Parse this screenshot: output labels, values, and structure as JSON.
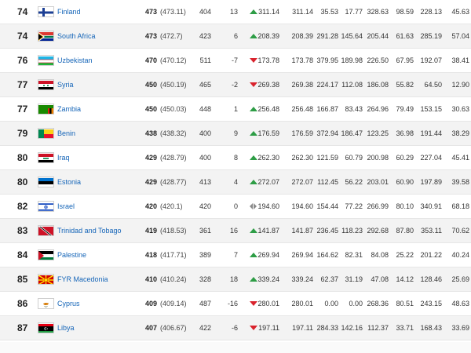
{
  "rows": [
    {
      "rank": "74",
      "country": "Finland",
      "flag": "finland-flag",
      "points": "473",
      "points_exact": "(473.11)",
      "prev_points": "404",
      "change": "13",
      "trend": "up",
      "c1": "311.14",
      "c2": "311.14",
      "c3": "35.53",
      "c4": "17.77",
      "c5": "328.63",
      "c6": "98.59",
      "c7": "228.13",
      "c8": "45.63"
    },
    {
      "rank": "74",
      "country": "South Africa",
      "flag": "south-africa-flag",
      "points": "473",
      "points_exact": "(472.7)",
      "prev_points": "423",
      "change": "6",
      "trend": "up",
      "c1": "208.39",
      "c2": "208.39",
      "c3": "291.28",
      "c4": "145.64",
      "c5": "205.44",
      "c6": "61.63",
      "c7": "285.19",
      "c8": "57.04"
    },
    {
      "rank": "76",
      "country": "Uzbekistan",
      "flag": "uzbekistan-flag",
      "points": "470",
      "points_exact": "(470.12)",
      "prev_points": "511",
      "change": "-7",
      "trend": "down",
      "c1": "173.78",
      "c2": "173.78",
      "c3": "379.95",
      "c4": "189.98",
      "c5": "226.50",
      "c6": "67.95",
      "c7": "192.07",
      "c8": "38.41"
    },
    {
      "rank": "77",
      "country": "Syria",
      "flag": "syria-flag",
      "points": "450",
      "points_exact": "(450.19)",
      "prev_points": "465",
      "change": "-2",
      "trend": "down",
      "c1": "269.38",
      "c2": "269.38",
      "c3": "224.17",
      "c4": "112.08",
      "c5": "186.08",
      "c6": "55.82",
      "c7": "64.50",
      "c8": "12.90"
    },
    {
      "rank": "77",
      "country": "Zambia",
      "flag": "zambia-flag",
      "points": "450",
      "points_exact": "(450.03)",
      "prev_points": "448",
      "change": "1",
      "trend": "up",
      "c1": "256.48",
      "c2": "256.48",
      "c3": "166.87",
      "c4": "83.43",
      "c5": "264.96",
      "c6": "79.49",
      "c7": "153.15",
      "c8": "30.63"
    },
    {
      "rank": "79",
      "country": "Benin",
      "flag": "benin-flag",
      "points": "438",
      "points_exact": "(438.32)",
      "prev_points": "400",
      "change": "9",
      "trend": "up",
      "c1": "176.59",
      "c2": "176.59",
      "c3": "372.94",
      "c4": "186.47",
      "c5": "123.25",
      "c6": "36.98",
      "c7": "191.44",
      "c8": "38.29"
    },
    {
      "rank": "80",
      "country": "Iraq",
      "flag": "iraq-flag",
      "points": "429",
      "points_exact": "(428.79)",
      "prev_points": "400",
      "change": "8",
      "trend": "up",
      "c1": "262.30",
      "c2": "262.30",
      "c3": "121.59",
      "c4": "60.79",
      "c5": "200.98",
      "c6": "60.29",
      "c7": "227.04",
      "c8": "45.41"
    },
    {
      "rank": "80",
      "country": "Estonia",
      "flag": "estonia-flag",
      "points": "429",
      "points_exact": "(428.77)",
      "prev_points": "413",
      "change": "4",
      "trend": "up",
      "c1": "272.07",
      "c2": "272.07",
      "c3": "112.45",
      "c4": "56.22",
      "c5": "203.01",
      "c6": "60.90",
      "c7": "197.89",
      "c8": "39.58"
    },
    {
      "rank": "82",
      "country": "Israel",
      "flag": "israel-flag",
      "points": "420",
      "points_exact": "(420.1)",
      "prev_points": "420",
      "change": "0",
      "trend": "same",
      "c1": "194.60",
      "c2": "194.60",
      "c3": "154.44",
      "c4": "77.22",
      "c5": "266.99",
      "c6": "80.10",
      "c7": "340.91",
      "c8": "68.18"
    },
    {
      "rank": "83",
      "country": "Trinidad and Tobago",
      "flag": "trinidad-and-tobago-flag",
      "points": "419",
      "points_exact": "(418.53)",
      "prev_points": "361",
      "change": "16",
      "trend": "up",
      "c1": "141.87",
      "c2": "141.87",
      "c3": "236.45",
      "c4": "118.23",
      "c5": "292.68",
      "c6": "87.80",
      "c7": "353.11",
      "c8": "70.62"
    },
    {
      "rank": "84",
      "country": "Palestine",
      "flag": "palestine-flag",
      "points": "418",
      "points_exact": "(417.71)",
      "prev_points": "389",
      "change": "7",
      "trend": "up",
      "c1": "269.94",
      "c2": "269.94",
      "c3": "164.62",
      "c4": "82.31",
      "c5": "84.08",
      "c6": "25.22",
      "c7": "201.22",
      "c8": "40.24"
    },
    {
      "rank": "85",
      "country": "FYR Macedonia",
      "flag": "fyr-macedonia-flag",
      "points": "410",
      "points_exact": "(410.24)",
      "prev_points": "328",
      "change": "18",
      "trend": "up",
      "c1": "339.24",
      "c2": "339.24",
      "c3": "62.37",
      "c4": "31.19",
      "c5": "47.08",
      "c6": "14.12",
      "c7": "128.46",
      "c8": "25.69"
    },
    {
      "rank": "86",
      "country": "Cyprus",
      "flag": "cyprus-flag",
      "points": "409",
      "points_exact": "(409.14)",
      "prev_points": "487",
      "change": "-16",
      "trend": "down",
      "c1": "280.01",
      "c2": "280.01",
      "c3": "0.00",
      "c4": "0.00",
      "c5": "268.36",
      "c6": "80.51",
      "c7": "243.15",
      "c8": "48.63"
    },
    {
      "rank": "87",
      "country": "Libya",
      "flag": "libya-flag",
      "points": "407",
      "points_exact": "(406.67)",
      "prev_points": "422",
      "change": "-6",
      "trend": "down",
      "c1": "197.11",
      "c2": "197.11",
      "c3": "284.33",
      "c4": "142.16",
      "c5": "112.37",
      "c6": "33.71",
      "c7": "168.43",
      "c8": "33.69"
    }
  ],
  "colors": {
    "row_alt": "#f3f3f3",
    "link": "#1565b8",
    "trend_up": "#2e9d46",
    "trend_down": "#d9232d",
    "trend_same": "#8a8a8a"
  }
}
